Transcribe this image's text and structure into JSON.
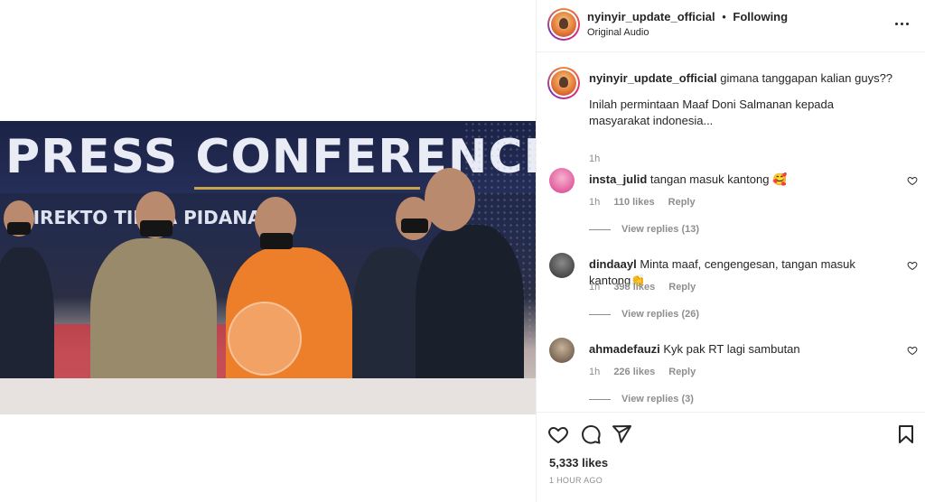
{
  "post": {
    "username": "nyinyir_update_official",
    "follow_status": "Following",
    "separator": "•",
    "audio": "Original Audio",
    "caption_line1": "gimana tanggapan kalian guys??",
    "caption_line2": "Inilah permintaan Maaf Doni Salmanan kepada masyarakat indonesia...",
    "caption_time": "1h",
    "likes": "5,333 likes",
    "posted_ago": "1 HOUR AGO"
  },
  "video": {
    "banner_text": "PRESS CONFERENCE",
    "sub_banner_text": "DIREKTO   TINDA   PIDANA   R"
  },
  "comments": [
    {
      "username": "insta_julid",
      "text": "tangan masuk kantong 🥰",
      "time": "1h",
      "likes": "110 likes",
      "reply": "Reply",
      "view_replies": "View replies (13)",
      "avatar_color": "#d83a8a"
    },
    {
      "username": "dindaayl",
      "text": "Minta maaf, cengengesan, tangan masuk kantong👏",
      "time": "1h",
      "likes": "398 likes",
      "reply": "Reply",
      "view_replies": "View replies (26)",
      "avatar_color": "#3a3a3a"
    },
    {
      "username": "ahmadefauzi",
      "text": "Kyk pak RT lagi sambutan",
      "time": "1h",
      "likes": "226 likes",
      "reply": "Reply",
      "view_replies": "View replies (3)",
      "avatar_color": "#6b5a48"
    }
  ],
  "icons": {
    "more": "more-options-icon",
    "like": "heart-icon",
    "comment": "comment-icon",
    "share": "share-icon",
    "save": "bookmark-icon"
  }
}
